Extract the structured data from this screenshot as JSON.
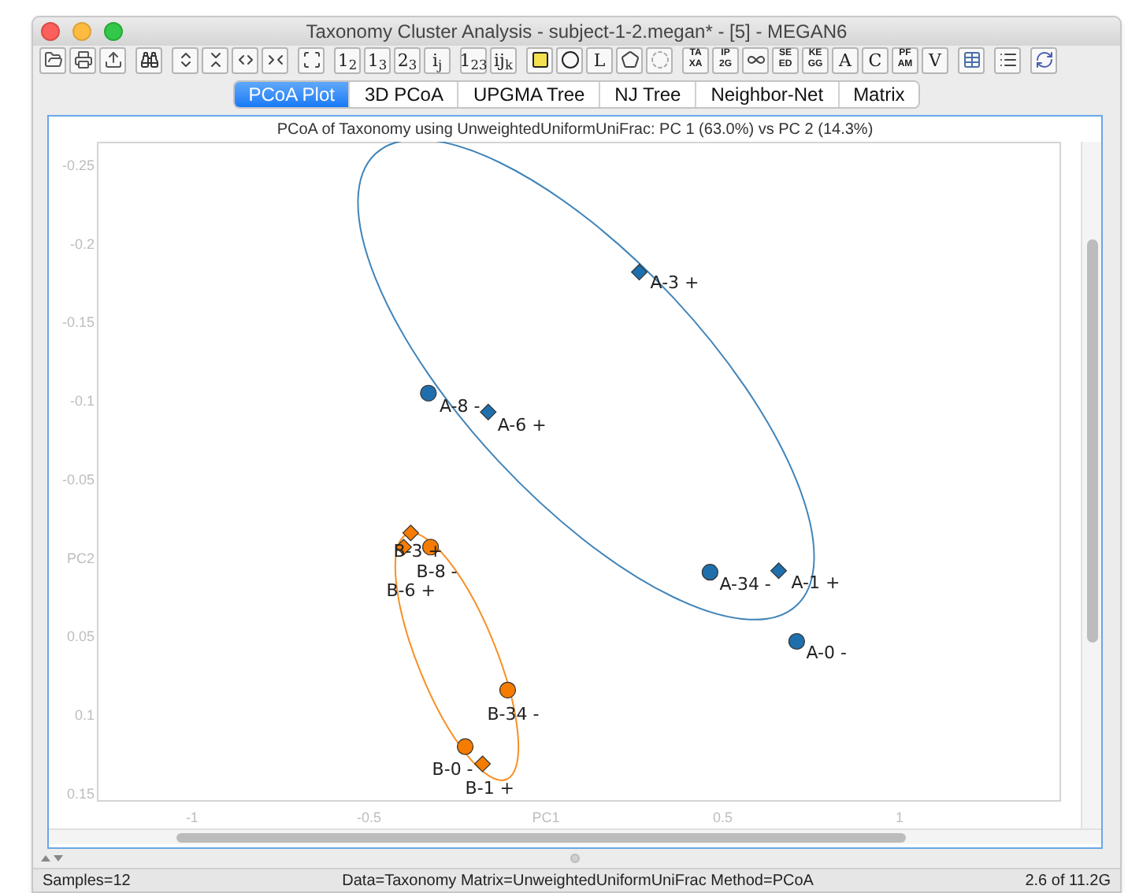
{
  "window": {
    "title": "Taxonomy Cluster Analysis - subject-1-2.megan* - [5] - MEGAN6"
  },
  "toolbar": [
    [
      {
        "kind": "icon"
      },
      {
        "kind": "icon"
      },
      {
        "kind": "icon"
      }
    ],
    [
      {
        "kind": "icon"
      }
    ],
    [
      {
        "kind": "icon"
      },
      {
        "kind": "icon"
      },
      {
        "kind": "icon"
      },
      {
        "kind": "icon"
      }
    ],
    [
      {
        "kind": "icon"
      }
    ],
    [
      {
        "kind": "text",
        "text": "1$_{2}$"
      },
      {
        "kind": "text",
        "text": "1$_{3}$"
      },
      {
        "kind": "text",
        "text": "2$_{3}$"
      },
      {
        "kind": "text",
        "text": "i$_{j}$"
      }
    ],
    [
      {
        "kind": "text",
        "text": "1$_{23}$"
      },
      {
        "kind": "text",
        "text": "ij$_{k}$"
      }
    ],
    [
      {
        "kind": "icon"
      },
      {
        "kind": "icon"
      },
      {
        "kind": "text",
        "text": "L"
      },
      {
        "kind": "icon"
      },
      {
        "kind": "icon"
      }
    ],
    [
      {
        "kind": "stack",
        "lines": [
          "TA",
          "XA"
        ]
      },
      {
        "kind": "stack",
        "lines": [
          "IP",
          "2G"
        ]
      },
      {
        "kind": "icon"
      },
      {
        "kind": "stack",
        "lines": [
          "SE",
          "ED"
        ]
      },
      {
        "kind": "stack",
        "lines": [
          "KE",
          "GG"
        ]
      },
      {
        "kind": "text",
        "text": "A"
      },
      {
        "kind": "text",
        "text": "C"
      },
      {
        "kind": "stack",
        "lines": [
          "PF",
          "AM"
        ]
      },
      {
        "kind": "text",
        "text": "V"
      }
    ],
    [
      {
        "kind": "icon"
      }
    ],
    [
      {
        "kind": "icon"
      }
    ],
    [
      {
        "kind": "icon"
      }
    ]
  ],
  "tabs": [
    {
      "label": "PCoA Plot",
      "selected": true
    },
    {
      "label": "3D PCoA",
      "selected": false
    },
    {
      "label": "UPGMA Tree",
      "selected": false
    },
    {
      "label": "NJ Tree",
      "selected": false
    },
    {
      "label": "Neighbor-Net",
      "selected": false
    },
    {
      "label": "Matrix",
      "selected": false
    }
  ],
  "plot": {
    "chart_data": {
      "type": "scatter",
      "title": "PCoA of Taxonomy using UnweightedUniformUniFrac: PC 1 (63.0%) vs PC 2 (14.3%)",
      "xlim": [
        -1.267,
        1.454
      ],
      "ylim": [
        0.154,
        -0.265
      ],
      "xticks": [
        {
          "value": -1,
          "label": "-1"
        },
        {
          "value": -0.5,
          "label": "-0.5"
        },
        {
          "value": 0,
          "label": "PC1"
        },
        {
          "value": 0.5,
          "label": "0.5"
        },
        {
          "value": 1,
          "label": "1"
        }
      ],
      "yticks": [
        {
          "value": -0.25,
          "label": "-0.25"
        },
        {
          "value": -0.2,
          "label": "-0.2"
        },
        {
          "value": -0.15,
          "label": "-0.15"
        },
        {
          "value": -0.1,
          "label": "-0.1"
        },
        {
          "value": -0.05,
          "label": "-0.05"
        },
        {
          "value": 0,
          "label": "PC2"
        },
        {
          "value": 0.05,
          "label": "0.05"
        },
        {
          "value": 0.1,
          "label": "0.1"
        },
        {
          "value": 0.15,
          "label": "0.15"
        }
      ],
      "series": [
        {
          "color": "#1f6fad",
          "marker": "diamond",
          "x": [
            0.264,
            -0.163,
            0.658
          ],
          "values": [
            -0.182,
            -0.093,
            0.008
          ]
        },
        {
          "color": "#1f6fad",
          "marker": "circle",
          "x": [
            -0.332,
            0.464,
            0.709
          ],
          "values": [
            -0.105,
            0.009,
            0.053
          ]
        },
        {
          "color": "#f57c00",
          "marker": "diamond",
          "x": [
            -0.382,
            -0.402,
            -0.179
          ],
          "values": [
            -0.016,
            -0.007,
            0.131
          ]
        },
        {
          "color": "#f57c00",
          "marker": "circle",
          "x": [
            -0.326,
            -0.108,
            -0.228
          ],
          "values": [
            -0.007,
            0.084,
            0.12
          ]
        }
      ],
      "annotations": [
        {
          "x": 0.264,
          "y": -0.182,
          "text": "A-3 +"
        },
        {
          "x": -0.332,
          "y": -0.105,
          "text": "A-8 -"
        },
        {
          "x": -0.163,
          "y": -0.093,
          "text": "A-6 +"
        },
        {
          "x": 0.464,
          "y": 0.009,
          "text": "A-34 -"
        },
        {
          "x": 0.658,
          "y": 0.008,
          "text": "A-1 +"
        },
        {
          "x": 0.709,
          "y": 0.053,
          "text": "A-0 -"
        },
        {
          "x": -0.382,
          "y": -0.016,
          "text": "B-3 +"
        },
        {
          "x": -0.326,
          "y": -0.007,
          "text": "B-8 -"
        },
        {
          "x": -0.402,
          "y": -0.007,
          "text": "B-6 +"
        },
        {
          "x": -0.108,
          "y": 0.084,
          "text": "B-34 -"
        },
        {
          "x": -0.228,
          "y": 0.12,
          "text": "B-0 -"
        },
        {
          "x": -0.179,
          "y": 0.131,
          "text": "B-1 +"
        }
      ]
    }
  },
  "status_bar": [
    "Samples=12",
    "Data=Taxonomy Matrix=UnweightedUniformUniFrac Method=PCoA",
    "2.6 of 11.2G"
  ]
}
